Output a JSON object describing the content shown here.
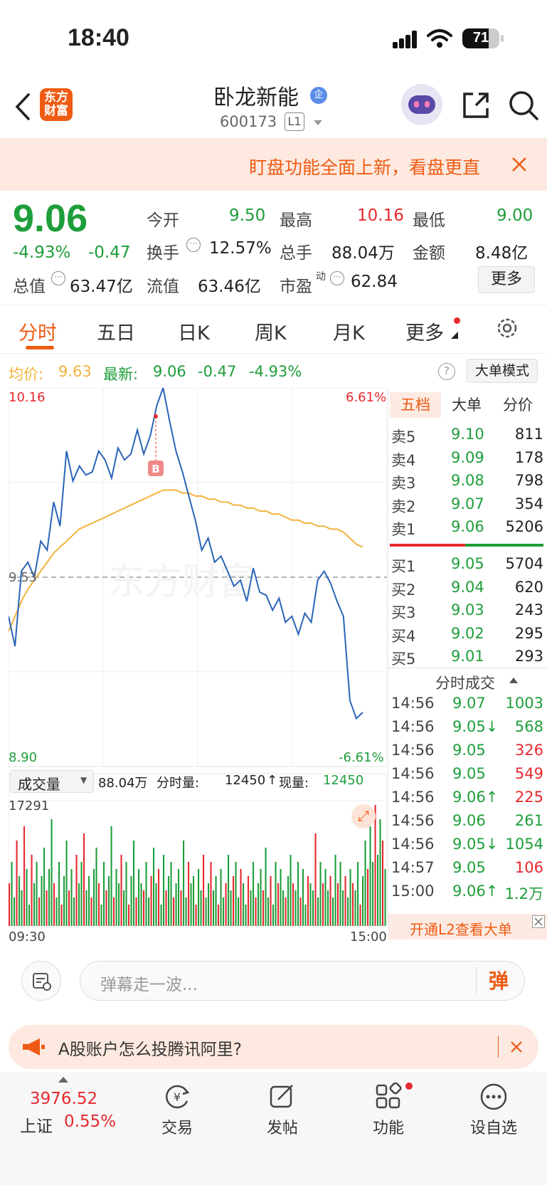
{
  "status_bar": {
    "time": "18:40",
    "battery": "71"
  },
  "header": {
    "brand_line1": "东方",
    "brand_line2": "财富",
    "stock_name": "卧龙新能",
    "badge": "企",
    "stock_code": "600173",
    "level": "L1"
  },
  "banner": {
    "text": "盯盘功能全面上新，看盘更直"
  },
  "quote": {
    "price": "9.06",
    "change_pct": "-4.93%",
    "change": "-0.47",
    "open_label": "今开",
    "open": "9.50",
    "high_label": "最高",
    "high": "10.16",
    "low_label": "最低",
    "low": "9.00",
    "turnover_label": "换手",
    "turnover": "12.57%",
    "volume_label": "总手",
    "volume": "88.04万",
    "amount_label": "金额",
    "amount": "8.48亿",
    "mktcap_label": "总值",
    "mktcap": "63.47亿",
    "float_label": "流值",
    "float_cap": "63.46亿",
    "pe_label": "市盈",
    "pe_sup": "动",
    "pe": "62.84",
    "more_label": "更多"
  },
  "tabs": [
    "分时",
    "五日",
    "日K",
    "周K",
    "月K",
    "更多"
  ],
  "info_line": {
    "avg_label": "均价:",
    "avg": "9.63",
    "latest_label": "最新:",
    "latest": "9.06",
    "latest_chg": "-0.47",
    "latest_pct": "-4.93%",
    "mode_button": "大单模式"
  },
  "chart_data": {
    "type": "line",
    "title": "",
    "x": [
      "09:30",
      "15:00"
    ],
    "y_labels": {
      "top": "10.16",
      "mid": "9.53",
      "bottom": "8.90",
      "top_pct": "6.61%",
      "bottom_pct": "-6.61%"
    },
    "ylim": [
      8.9,
      10.16
    ],
    "prev_close": 9.53,
    "series": [
      {
        "name": "price",
        "color": "#2a64b8",
        "values": [
          9.4,
          9.3,
          9.55,
          9.58,
          9.53,
          9.65,
          9.62,
          9.78,
          9.7,
          9.95,
          9.85,
          9.9,
          9.87,
          9.88,
          9.95,
          9.92,
          9.86,
          9.96,
          9.92,
          9.94,
          10.02,
          9.94,
          10.0,
          10.1,
          10.16,
          10.05,
          9.95,
          9.88,
          9.8,
          9.72,
          9.62,
          9.66,
          9.58,
          9.6,
          9.55,
          9.5,
          9.52,
          9.45,
          9.56,
          9.48,
          9.47,
          9.42,
          9.46,
          9.38,
          9.4,
          9.34,
          9.41,
          9.38,
          9.52,
          9.55,
          9.51,
          9.45,
          9.4,
          9.12,
          9.06,
          9.08
        ]
      },
      {
        "name": "avg",
        "color": "#f2b33d",
        "values": [
          9.35,
          9.4,
          9.45,
          9.49,
          9.52,
          9.55,
          9.58,
          9.61,
          9.63,
          9.65,
          9.67,
          9.69,
          9.7,
          9.71,
          9.72,
          9.73,
          9.74,
          9.75,
          9.76,
          9.77,
          9.78,
          9.79,
          9.8,
          9.81,
          9.82,
          9.82,
          9.82,
          9.81,
          9.81,
          9.8,
          9.8,
          9.79,
          9.79,
          9.78,
          9.78,
          9.77,
          9.77,
          9.76,
          9.76,
          9.75,
          9.75,
          9.74,
          9.74,
          9.73,
          9.72,
          9.72,
          9.71,
          9.71,
          9.7,
          9.7,
          9.69,
          9.69,
          9.68,
          9.66,
          9.64,
          9.63
        ]
      }
    ]
  },
  "volume": {
    "selector": "成交量",
    "total": "88.04万",
    "period_label": "分时量:",
    "period_value": "12450",
    "now_label": "现量:",
    "now_value": "12450",
    "max": "17291",
    "start": "09:30",
    "end": "15:00",
    "bars": [
      6,
      9,
      4,
      12,
      7,
      5,
      14,
      8,
      3,
      10,
      6,
      9,
      4,
      7,
      11,
      5,
      8,
      15,
      6,
      4,
      9,
      3,
      7,
      12,
      5,
      8,
      4,
      10,
      6,
      9,
      13,
      5,
      7,
      4,
      8,
      11,
      6,
      3,
      9,
      5,
      7,
      14,
      4,
      8,
      6,
      10,
      5,
      9,
      3,
      7,
      12,
      4,
      8,
      6,
      5,
      9,
      4,
      7,
      11,
      6,
      8,
      3,
      10,
      5,
      7,
      9,
      4,
      6,
      8,
      5,
      12,
      4,
      9,
      6,
      7,
      3,
      8,
      5,
      10,
      4,
      6,
      9,
      5,
      7,
      3,
      8,
      4,
      6,
      10,
      5,
      7,
      9,
      4,
      8,
      6,
      3,
      7,
      5,
      9,
      4,
      6,
      8,
      5,
      11,
      4,
      7,
      3,
      9,
      6,
      8,
      5,
      4,
      7,
      10,
      6,
      5,
      9,
      4,
      8,
      3,
      7,
      6,
      5,
      13,
      4,
      9,
      6,
      8,
      5,
      7,
      4,
      10,
      6,
      9,
      5,
      7,
      4,
      8,
      6,
      5,
      9,
      3,
      7,
      12,
      8,
      14,
      9,
      17,
      10,
      15,
      12,
      8
    ]
  },
  "order_book": {
    "tabs": [
      "五档",
      "大单",
      "分价"
    ],
    "asks": [
      {
        "label": "卖5",
        "price": "9.10",
        "vol": "811"
      },
      {
        "label": "卖4",
        "price": "9.09",
        "vol": "178"
      },
      {
        "label": "卖3",
        "price": "9.08",
        "vol": "798"
      },
      {
        "label": "卖2",
        "price": "9.07",
        "vol": "354"
      },
      {
        "label": "卖1",
        "price": "9.06",
        "vol": "5206"
      }
    ],
    "bids": [
      {
        "label": "买1",
        "price": "9.05",
        "vol": "5704"
      },
      {
        "label": "买2",
        "price": "9.04",
        "vol": "620"
      },
      {
        "label": "买3",
        "price": "9.03",
        "vol": "243"
      },
      {
        "label": "买4",
        "price": "9.02",
        "vol": "295"
      },
      {
        "label": "买5",
        "price": "9.01",
        "vol": "293"
      }
    ],
    "ticks_title": "分时成交",
    "ticks": [
      {
        "time": "14:56",
        "price": "9.07",
        "vol": "1003",
        "pc": "green",
        "vc": "green"
      },
      {
        "time": "14:56",
        "price": "9.05↓",
        "vol": "568",
        "pc": "green",
        "vc": "green"
      },
      {
        "time": "14:56",
        "price": "9.05",
        "vol": "326",
        "pc": "green",
        "vc": "red"
      },
      {
        "time": "14:56",
        "price": "9.05",
        "vol": "549",
        "pc": "green",
        "vc": "red"
      },
      {
        "time": "14:56",
        "price": "9.06↑",
        "vol": "225",
        "pc": "green",
        "vc": "red"
      },
      {
        "time": "14:56",
        "price": "9.06",
        "vol": "261",
        "pc": "green",
        "vc": "green"
      },
      {
        "time": "14:56",
        "price": "9.05↓",
        "vol": "1054",
        "pc": "green",
        "vc": "green"
      },
      {
        "time": "14:57",
        "price": "9.05",
        "vol": "106",
        "pc": "green",
        "vc": "red"
      },
      {
        "time": "15:00",
        "price": "9.06↑",
        "vol": "1.2万",
        "pc": "green",
        "vc": "green"
      }
    ],
    "l2_text": "开通L2查看大单"
  },
  "danmu": {
    "placeholder": "弹幕走一波...",
    "button": "弹"
  },
  "ad": {
    "text": "A股账户怎么投腾讯阿里?"
  },
  "bottom_nav": {
    "index_value": "3976.52",
    "index_name": "上证",
    "index_pct": "0.55%",
    "items": [
      "交易",
      "发帖",
      "功能",
      "设自选"
    ]
  }
}
